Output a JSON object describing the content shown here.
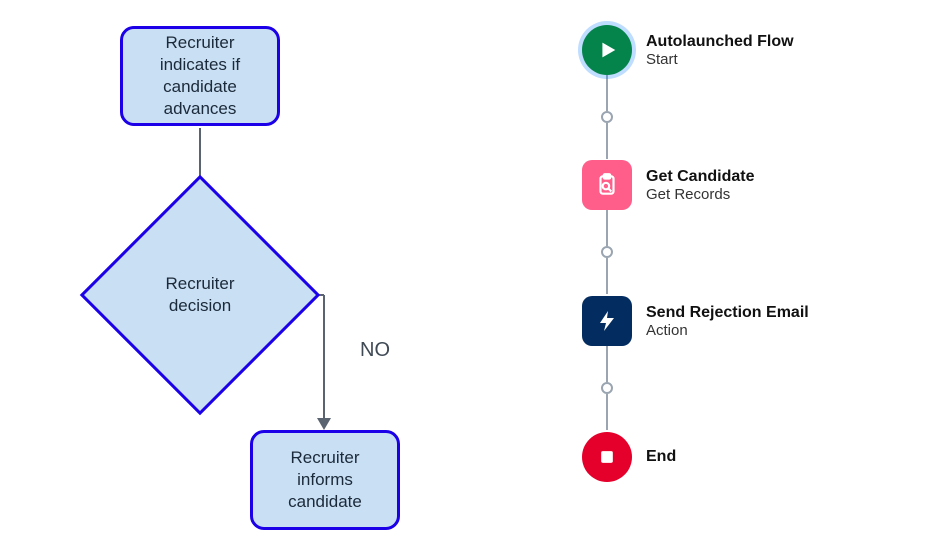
{
  "left_flowchart": {
    "nodes": {
      "start_box": "Recruiter indicates if candidate advances",
      "decision": "Recruiter decision",
      "inform_box": "Recruiter informs candidate"
    },
    "edge_labels": {
      "no": "NO"
    }
  },
  "right_flow": {
    "nodes": [
      {
        "title": "Autolaunched Flow",
        "subtitle": "Start",
        "icon": "play-icon",
        "shape": "circle",
        "color": "#04844b"
      },
      {
        "title": "Get Candidate",
        "subtitle": "Get Records",
        "icon": "clipboard-search-icon",
        "shape": "square",
        "color": "#ff5d8a"
      },
      {
        "title": "Send Rejection Email",
        "subtitle": "Action",
        "icon": "lightning-icon",
        "shape": "square",
        "color": "#032d60"
      },
      {
        "title": "End",
        "subtitle": "",
        "icon": "stop-icon",
        "shape": "circle",
        "color": "#e4002b"
      }
    ]
  }
}
